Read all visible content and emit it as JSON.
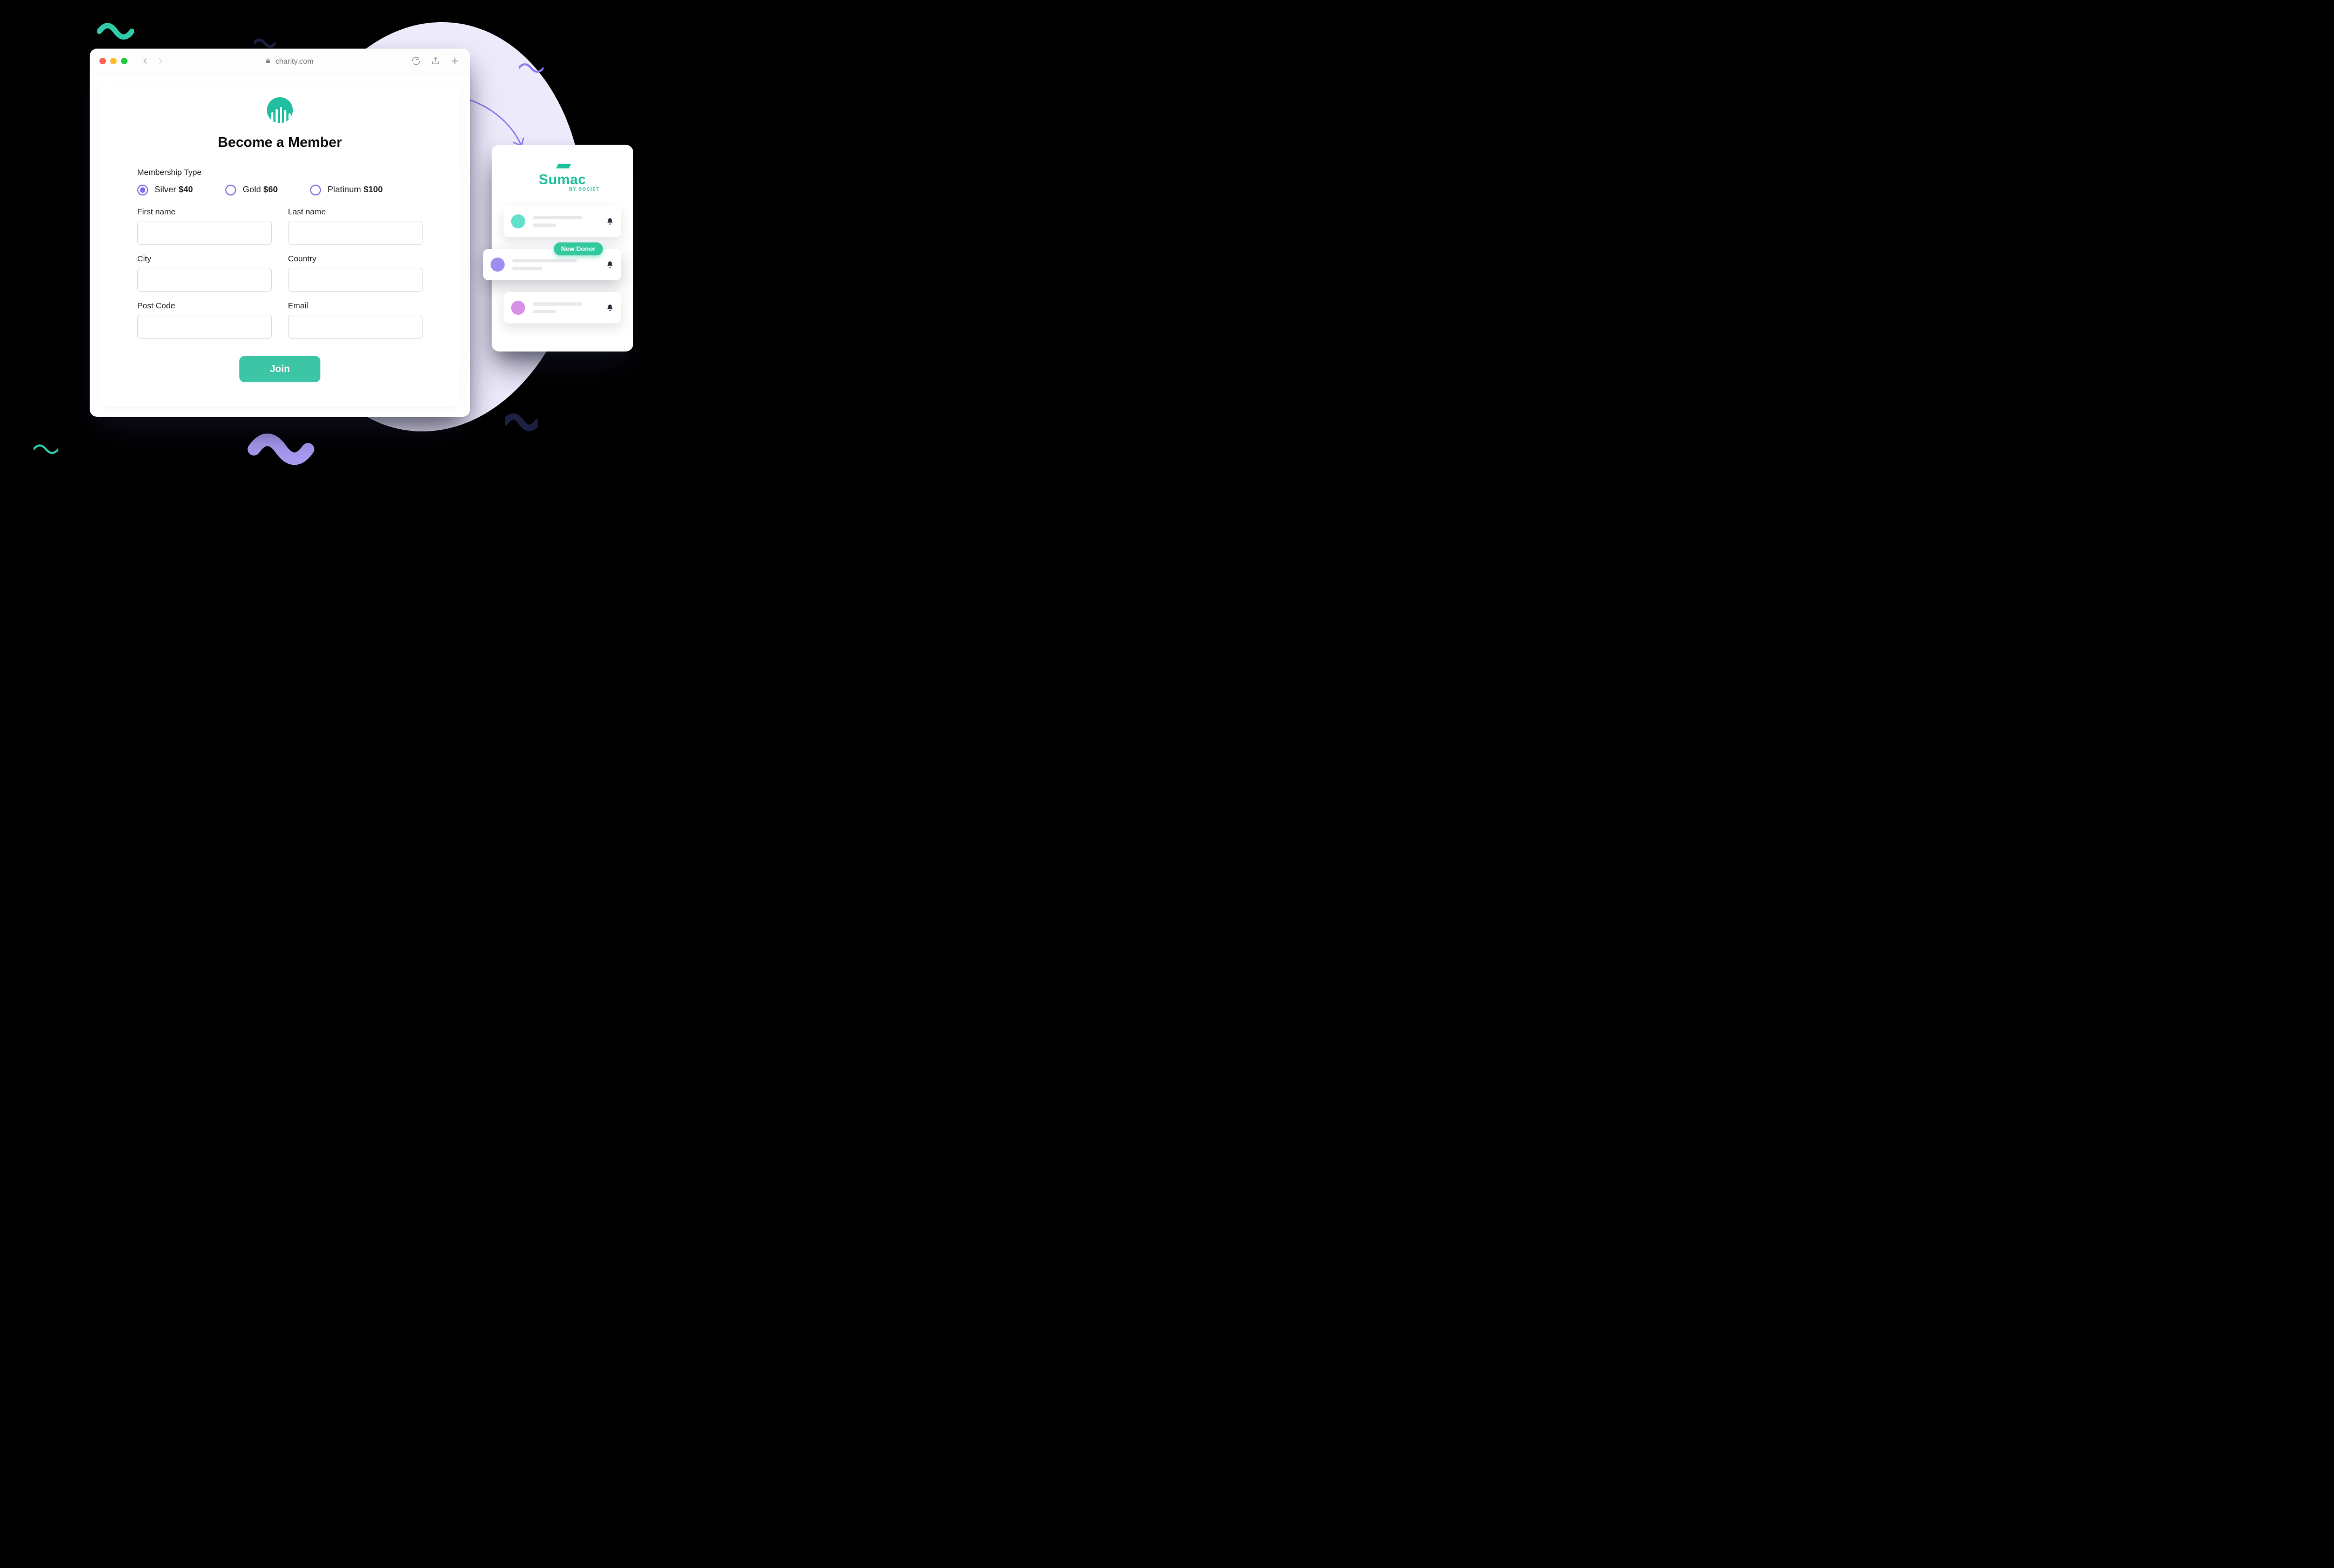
{
  "browser": {
    "url_display": "charity.com"
  },
  "form": {
    "title": "Become a Member",
    "membership_label": "Membership Type",
    "options": [
      {
        "name": "Silver",
        "price": "$40",
        "selected": true
      },
      {
        "name": "Gold",
        "price": "$60",
        "selected": false
      },
      {
        "name": "Platinum",
        "price": "$100",
        "selected": false
      }
    ],
    "fields": {
      "first_name": "First name",
      "last_name": "Last name",
      "city": "City",
      "country": "Country",
      "post_code": "Post Code",
      "email": "Email"
    },
    "submit_label": "Join"
  },
  "crm": {
    "brand": "Sumac",
    "byline": "BY SOCIET",
    "new_donor_badge": "New Donor"
  },
  "colors": {
    "accent_teal": "#3DC6A5",
    "accent_purple": "#7b6fe6",
    "bg_ellipse": "#ECEAFB"
  }
}
